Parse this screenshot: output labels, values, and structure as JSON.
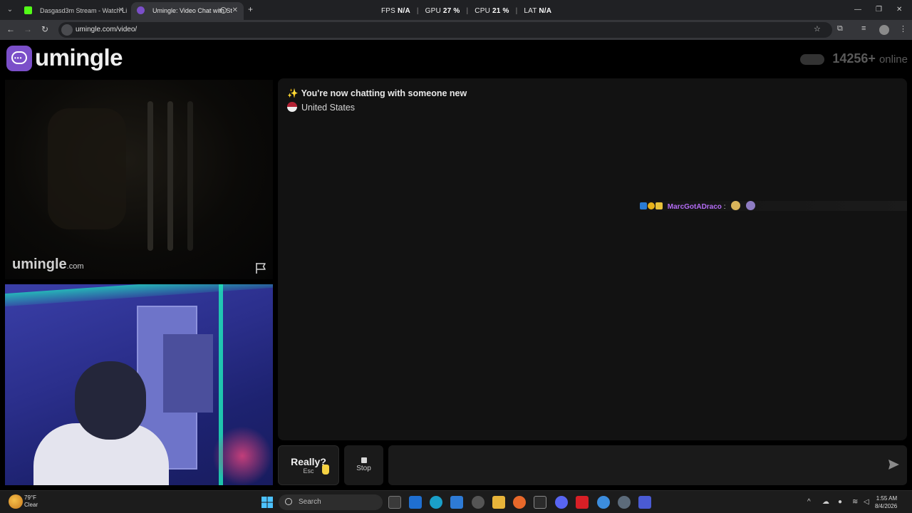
{
  "browser": {
    "tabs": [
      {
        "title": "Dasgasd3m Stream - Watch Li",
        "active": false
      },
      {
        "title": "Umingle: Video Chat with St",
        "active": true
      }
    ],
    "perf_overlay": {
      "fps_label": "FPS",
      "fps": "N/A",
      "gpu_label": "GPU",
      "gpu": "27 %",
      "cpu_label": "CPU",
      "cpu": "21 %",
      "lat_label": "LAT",
      "lat": "N/A"
    },
    "url": "umingle.com/video/"
  },
  "site": {
    "logo_text": "umingle",
    "online_count": "14256+",
    "online_label": "online",
    "watermark_main": "umingle",
    "watermark_suffix": ".com",
    "accent_color": "#7b4fc9"
  },
  "chat": {
    "system_message": "You're now chatting with someone new",
    "system_icon": "sparkles-icon",
    "country": "United States",
    "overlay_username": "MarcGotADraco",
    "overlay_separator": ":",
    "overlay_username_color": "#b46cf5",
    "input_value": ""
  },
  "controls": {
    "skip_label": "Really?",
    "skip_hint": "Esc",
    "stop_label": "Stop"
  },
  "taskbar": {
    "weather_temp": "79°F",
    "weather_cond": "Clear",
    "search_label": "Search",
    "time": "1:55 AM",
    "date": "8/4/2026"
  }
}
